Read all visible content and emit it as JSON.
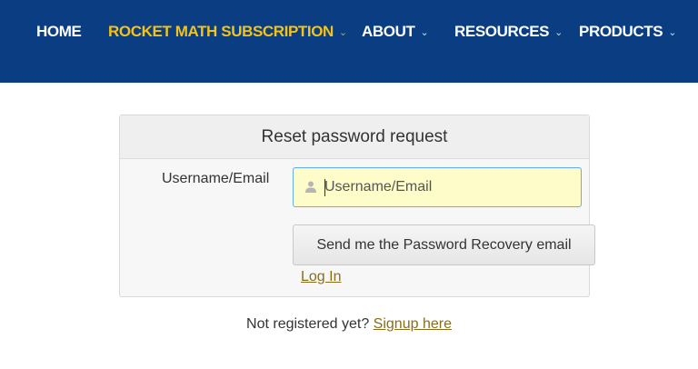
{
  "nav": {
    "items": [
      {
        "label": "HOME",
        "has_dropdown": false
      },
      {
        "label": "ROCKET MATH SUBSCRIPTION",
        "has_dropdown": true,
        "active": true
      },
      {
        "label": "ABOUT",
        "has_dropdown": true
      },
      {
        "label": "RESOURCES",
        "has_dropdown": true
      },
      {
        "label": "PRODUCTS",
        "has_dropdown": true
      }
    ],
    "dropdown_glyph": "⌄"
  },
  "form": {
    "title": "Reset password request",
    "username_label": "Username/Email",
    "username_placeholder": "Username/Email",
    "username_value": "",
    "submit_label": "Send me the Password Recovery email",
    "login_link": "Log In"
  },
  "footer": {
    "prompt": "Not registered yet?",
    "signup_link": "Signup here"
  },
  "colors": {
    "nav_bg": "#0a3d82",
    "nav_active": "#f4c31a",
    "link": "#8a6d1a",
    "input_bg": "#fefdc9"
  },
  "icons": {
    "username_field_icon": "user-icon"
  }
}
